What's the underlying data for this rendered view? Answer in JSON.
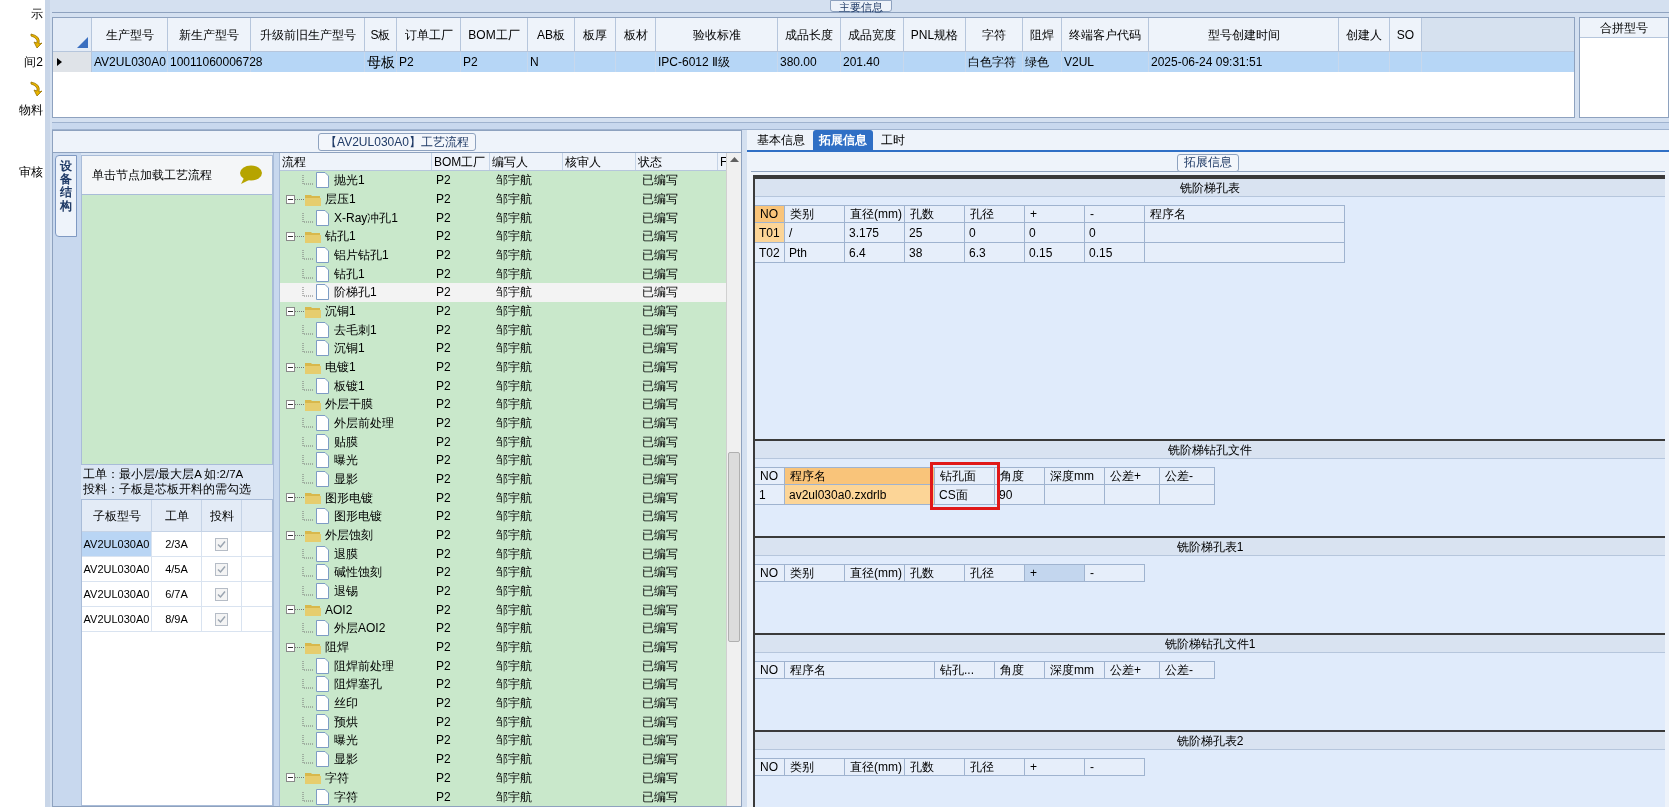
{
  "sidebar": {
    "items": [
      {
        "label": "示",
        "icon": false
      },
      {
        "label": "间2",
        "icon": true
      },
      {
        "label": "物料",
        "icon": true
      },
      {
        "label": "审核",
        "icon": false
      }
    ]
  },
  "main_info": {
    "title": "主要信息",
    "columns": [
      "生产型号",
      "新生产型号",
      "升级前旧生产型号",
      "S板",
      "订单工厂",
      "BOM工厂",
      "AB板",
      "板厚",
      "板材",
      "验收标准",
      "成品长度",
      "成品宽度",
      "PNL规格",
      "字符",
      "阻焊",
      "终端客户代码",
      "型号创建时间",
      "创建人",
      "SO"
    ],
    "rows": [
      {
        "selected": true,
        "cells": [
          "AV2UL030A0",
          "10011060006728",
          null,
          "母板",
          "P2",
          "P2",
          "N",
          null,
          null,
          "IPC-6012 Ⅱ级",
          "380.00",
          "201.40",
          null,
          "白色字符",
          "绿色",
          "V2UL",
          "2025-06-24 09:31:51",
          null,
          null
        ]
      }
    ]
  },
  "merge_panel": {
    "title": "合拼型号"
  },
  "process": {
    "title": "【AV2UL030A0】工艺流程",
    "side_tab": "设备结构",
    "hint": "单击节点加载工艺流程",
    "notes": [
      "工单：最小层/最大层A 如:2/7A",
      "投料：子板是芯板开料的需勾选"
    ],
    "sub_table": {
      "columns": [
        "子板型号",
        "工单",
        "投料"
      ],
      "rows": [
        {
          "model": "AV2UL030A0",
          "order": "2/3A",
          "checked": true,
          "selected": true
        },
        {
          "model": "AV2UL030A0",
          "order": "4/5A",
          "checked": true,
          "selected": false
        },
        {
          "model": "AV2UL030A0",
          "order": "6/7A",
          "checked": true,
          "selected": false
        },
        {
          "model": "AV2UL030A0",
          "order": "8/9A",
          "checked": true,
          "selected": false
        }
      ]
    },
    "tree": {
      "columns": [
        "流程",
        "BOM工厂",
        "编写人",
        "核审人",
        "状态",
        "F"
      ],
      "items": [
        {
          "name": "抛光1",
          "kind": "file",
          "bom": "P2",
          "writer": "邹宇航",
          "status": "已编写",
          "selected": false
        },
        {
          "name": "层压1",
          "kind": "folder",
          "bom": "P2",
          "writer": "邹宇航",
          "status": "已编写",
          "selected": false,
          "children": [
            {
              "name": "X-Ray冲孔1",
              "kind": "file",
              "bom": "P2",
              "writer": "邹宇航",
              "status": "已编写",
              "selected": false
            }
          ]
        },
        {
          "name": "钻孔1",
          "kind": "folder",
          "bom": "P2",
          "writer": "邹宇航",
          "status": "已编写",
          "selected": false,
          "children": [
            {
              "name": "铝片钻孔1",
              "kind": "file",
              "bom": "P2",
              "writer": "邹宇航",
              "status": "已编写",
              "selected": false
            },
            {
              "name": "钻孔1",
              "kind": "file",
              "bom": "P2",
              "writer": "邹宇航",
              "status": "已编写",
              "selected": false
            },
            {
              "name": "阶梯孔1",
              "kind": "file",
              "bom": "P2",
              "writer": "邹宇航",
              "status": "已编写",
              "selected": true
            }
          ]
        },
        {
          "name": "沉铜1",
          "kind": "folder",
          "bom": "P2",
          "writer": "邹宇航",
          "status": "已编写",
          "selected": false,
          "children": [
            {
              "name": "去毛刺1",
              "kind": "file",
              "bom": "P2",
              "writer": "邹宇航",
              "status": "已编写",
              "selected": false
            },
            {
              "name": "沉铜1",
              "kind": "file",
              "bom": "P2",
              "writer": "邹宇航",
              "status": "已编写",
              "selected": false
            }
          ]
        },
        {
          "name": "电镀1",
          "kind": "folder",
          "bom": "P2",
          "writer": "邹宇航",
          "status": "已编写",
          "selected": false,
          "children": [
            {
              "name": "板镀1",
              "kind": "file",
              "bom": "P2",
              "writer": "邹宇航",
              "status": "已编写",
              "selected": false
            }
          ]
        },
        {
          "name": "外层干膜",
          "kind": "folder",
          "bom": "P2",
          "writer": "邹宇航",
          "status": "已编写",
          "selected": false,
          "children": [
            {
              "name": "外层前处理",
              "kind": "file",
              "bom": "P2",
              "writer": "邹宇航",
              "status": "已编写",
              "selected": false
            },
            {
              "name": "贴膜",
              "kind": "file",
              "bom": "P2",
              "writer": "邹宇航",
              "status": "已编写",
              "selected": false
            },
            {
              "name": "曝光",
              "kind": "file",
              "bom": "P2",
              "writer": "邹宇航",
              "status": "已编写",
              "selected": false
            },
            {
              "name": "显影",
              "kind": "file",
              "bom": "P2",
              "writer": "邹宇航",
              "status": "已编写",
              "selected": false
            }
          ]
        },
        {
          "name": "图形电镀",
          "kind": "folder",
          "bom": "P2",
          "writer": "邹宇航",
          "status": "已编写",
          "selected": false,
          "children": [
            {
              "name": "图形电镀",
              "kind": "file",
              "bom": "P2",
              "writer": "邹宇航",
              "status": "已编写",
              "selected": false
            }
          ]
        },
        {
          "name": "外层蚀刻",
          "kind": "folder",
          "bom": "P2",
          "writer": "邹宇航",
          "status": "已编写",
          "selected": false,
          "children": [
            {
              "name": "退膜",
              "kind": "file",
              "bom": "P2",
              "writer": "邹宇航",
              "status": "已编写",
              "selected": false
            },
            {
              "name": "碱性蚀刻",
              "kind": "file",
              "bom": "P2",
              "writer": "邹宇航",
              "status": "已编写",
              "selected": false
            },
            {
              "name": "退锡",
              "kind": "file",
              "bom": "P2",
              "writer": "邹宇航",
              "status": "已编写",
              "selected": false
            }
          ]
        },
        {
          "name": "AOI2",
          "kind": "folder",
          "bom": "P2",
          "writer": "邹宇航",
          "status": "已编写",
          "selected": false,
          "children": [
            {
              "name": "外层AOI2",
              "kind": "file",
              "bom": "P2",
              "writer": "邹宇航",
              "status": "已编写",
              "selected": false
            }
          ]
        },
        {
          "name": "阻焊",
          "kind": "folder",
          "bom": "P2",
          "writer": "邹宇航",
          "status": "已编写",
          "selected": false,
          "children": [
            {
              "name": "阻焊前处理",
              "kind": "file",
              "bom": "P2",
              "writer": "邹宇航",
              "status": "已编写",
              "selected": false
            },
            {
              "name": "阻焊塞孔",
              "kind": "file",
              "bom": "P2",
              "writer": "邹宇航",
              "status": "已编写",
              "selected": false
            },
            {
              "name": "丝印",
              "kind": "file",
              "bom": "P2",
              "writer": "邹宇航",
              "status": "已编写",
              "selected": false
            },
            {
              "name": "预烘",
              "kind": "file",
              "bom": "P2",
              "writer": "邹宇航",
              "status": "已编写",
              "selected": false
            },
            {
              "name": "曝光",
              "kind": "file",
              "bom": "P2",
              "writer": "邹宇航",
              "status": "已编写",
              "selected": false
            },
            {
              "name": "显影",
              "kind": "file",
              "bom": "P2",
              "writer": "邹宇航",
              "status": "已编写",
              "selected": false
            }
          ]
        },
        {
          "name": "字符",
          "kind": "folder",
          "bom": "P2",
          "writer": "邹宇航",
          "status": "已编写",
          "selected": false,
          "children": [
            {
              "name": "字符",
              "kind": "file",
              "bom": "P2",
              "writer": "邹宇航",
              "status": "已编写",
              "selected": false
            }
          ]
        }
      ]
    }
  },
  "detail": {
    "tabs": [
      {
        "label": "基本信息",
        "selected": false
      },
      {
        "label": "拓展信息",
        "selected": true
      },
      {
        "label": "工时",
        "selected": false
      }
    ],
    "group_title": "拓展信息",
    "sections": [
      {
        "title": "铣阶梯孔表",
        "kind": "hole_table",
        "columns": [
          {
            "label": "NO",
            "selected": true,
            "hovered": false
          },
          {
            "label": "类别",
            "selected": false,
            "hovered": false
          },
          {
            "label": "直径(mm)",
            "selected": false,
            "hovered": false
          },
          {
            "label": "孔数",
            "selected": false,
            "hovered": false
          },
          {
            "label": "孔径",
            "selected": false,
            "hovered": false
          },
          {
            "label": "+",
            "selected": false,
            "hovered": false
          },
          {
            "label": "-",
            "selected": false,
            "hovered": false
          },
          {
            "label": "程序名",
            "selected": false,
            "hovered": false
          }
        ],
        "rows": [
          {
            "selected": true,
            "cells": [
              "T01",
              "/",
              "3.175",
              "25",
              "0",
              "0",
              "0",
              null
            ]
          },
          {
            "selected": false,
            "cells": [
              "T02",
              "Pth",
              "6.4",
              "38",
              "6.3",
              "0.15",
              "0.15",
              null
            ]
          }
        ]
      },
      {
        "title": "铣阶梯钻孔文件",
        "kind": "drill_file",
        "columns": [
          {
            "label": "NO",
            "selected": false,
            "hovered": false,
            "framed": false
          },
          {
            "label": "程序名",
            "selected": true,
            "hovered": false,
            "framed": false
          },
          {
            "label": "钻孔面",
            "selected": false,
            "hovered": false,
            "framed": true
          },
          {
            "label": "角度",
            "selected": false,
            "hovered": false,
            "framed": false
          },
          {
            "label": "深度mm",
            "selected": false,
            "hovered": false,
            "framed": false
          },
          {
            "label": "公差+",
            "selected": false,
            "hovered": false,
            "framed": false
          },
          {
            "label": "公差-",
            "selected": false,
            "hovered": false,
            "framed": false
          }
        ],
        "rows": [
          {
            "selected": true,
            "cells": [
              "1",
              "av2ul030a0.zxdrlb",
              "CS面",
              "90",
              null,
              null,
              null
            ]
          }
        ]
      },
      {
        "title": "铣阶梯孔表1",
        "kind": "hole_table",
        "columns": [
          {
            "label": "NO",
            "selected": false,
            "hovered": false
          },
          {
            "label": "类别",
            "selected": false,
            "hovered": false
          },
          {
            "label": "直径(mm)",
            "selected": false,
            "hovered": false
          },
          {
            "label": "孔数",
            "selected": false,
            "hovered": false
          },
          {
            "label": "孔径",
            "selected": false,
            "hovered": false
          },
          {
            "label": "+",
            "selected": false,
            "hovered": true
          },
          {
            "label": "-",
            "selected": false,
            "hovered": false
          }
        ]
      },
      {
        "title": "铣阶梯钻孔文件1",
        "kind": "drill_file",
        "columns": [
          {
            "label": "NO",
            "selected": false,
            "hovered": false
          },
          {
            "label": "程序名",
            "selected": false,
            "hovered": false
          },
          {
            "label": "钻孔...",
            "selected": false,
            "hovered": false
          },
          {
            "label": "角度",
            "selected": false,
            "hovered": false
          },
          {
            "label": "深度mm",
            "selected": false,
            "hovered": false
          },
          {
            "label": "公差+",
            "selected": false,
            "hovered": false
          },
          {
            "label": "公差-",
            "selected": false,
            "hovered": false
          }
        ]
      },
      {
        "title": "铣阶梯孔表2",
        "kind": "hole_table",
        "columns": [
          {
            "label": "NO",
            "selected": false,
            "hovered": false
          },
          {
            "label": "类别",
            "selected": false,
            "hovered": false
          },
          {
            "label": "直径(mm)",
            "selected": false,
            "hovered": false
          },
          {
            "label": "孔数",
            "selected": false,
            "hovered": false
          },
          {
            "label": "孔径",
            "selected": false,
            "hovered": false
          },
          {
            "label": "+",
            "selected": false,
            "hovered": false
          },
          {
            "label": "-",
            "selected": false,
            "hovered": false
          }
        ]
      }
    ]
  }
}
